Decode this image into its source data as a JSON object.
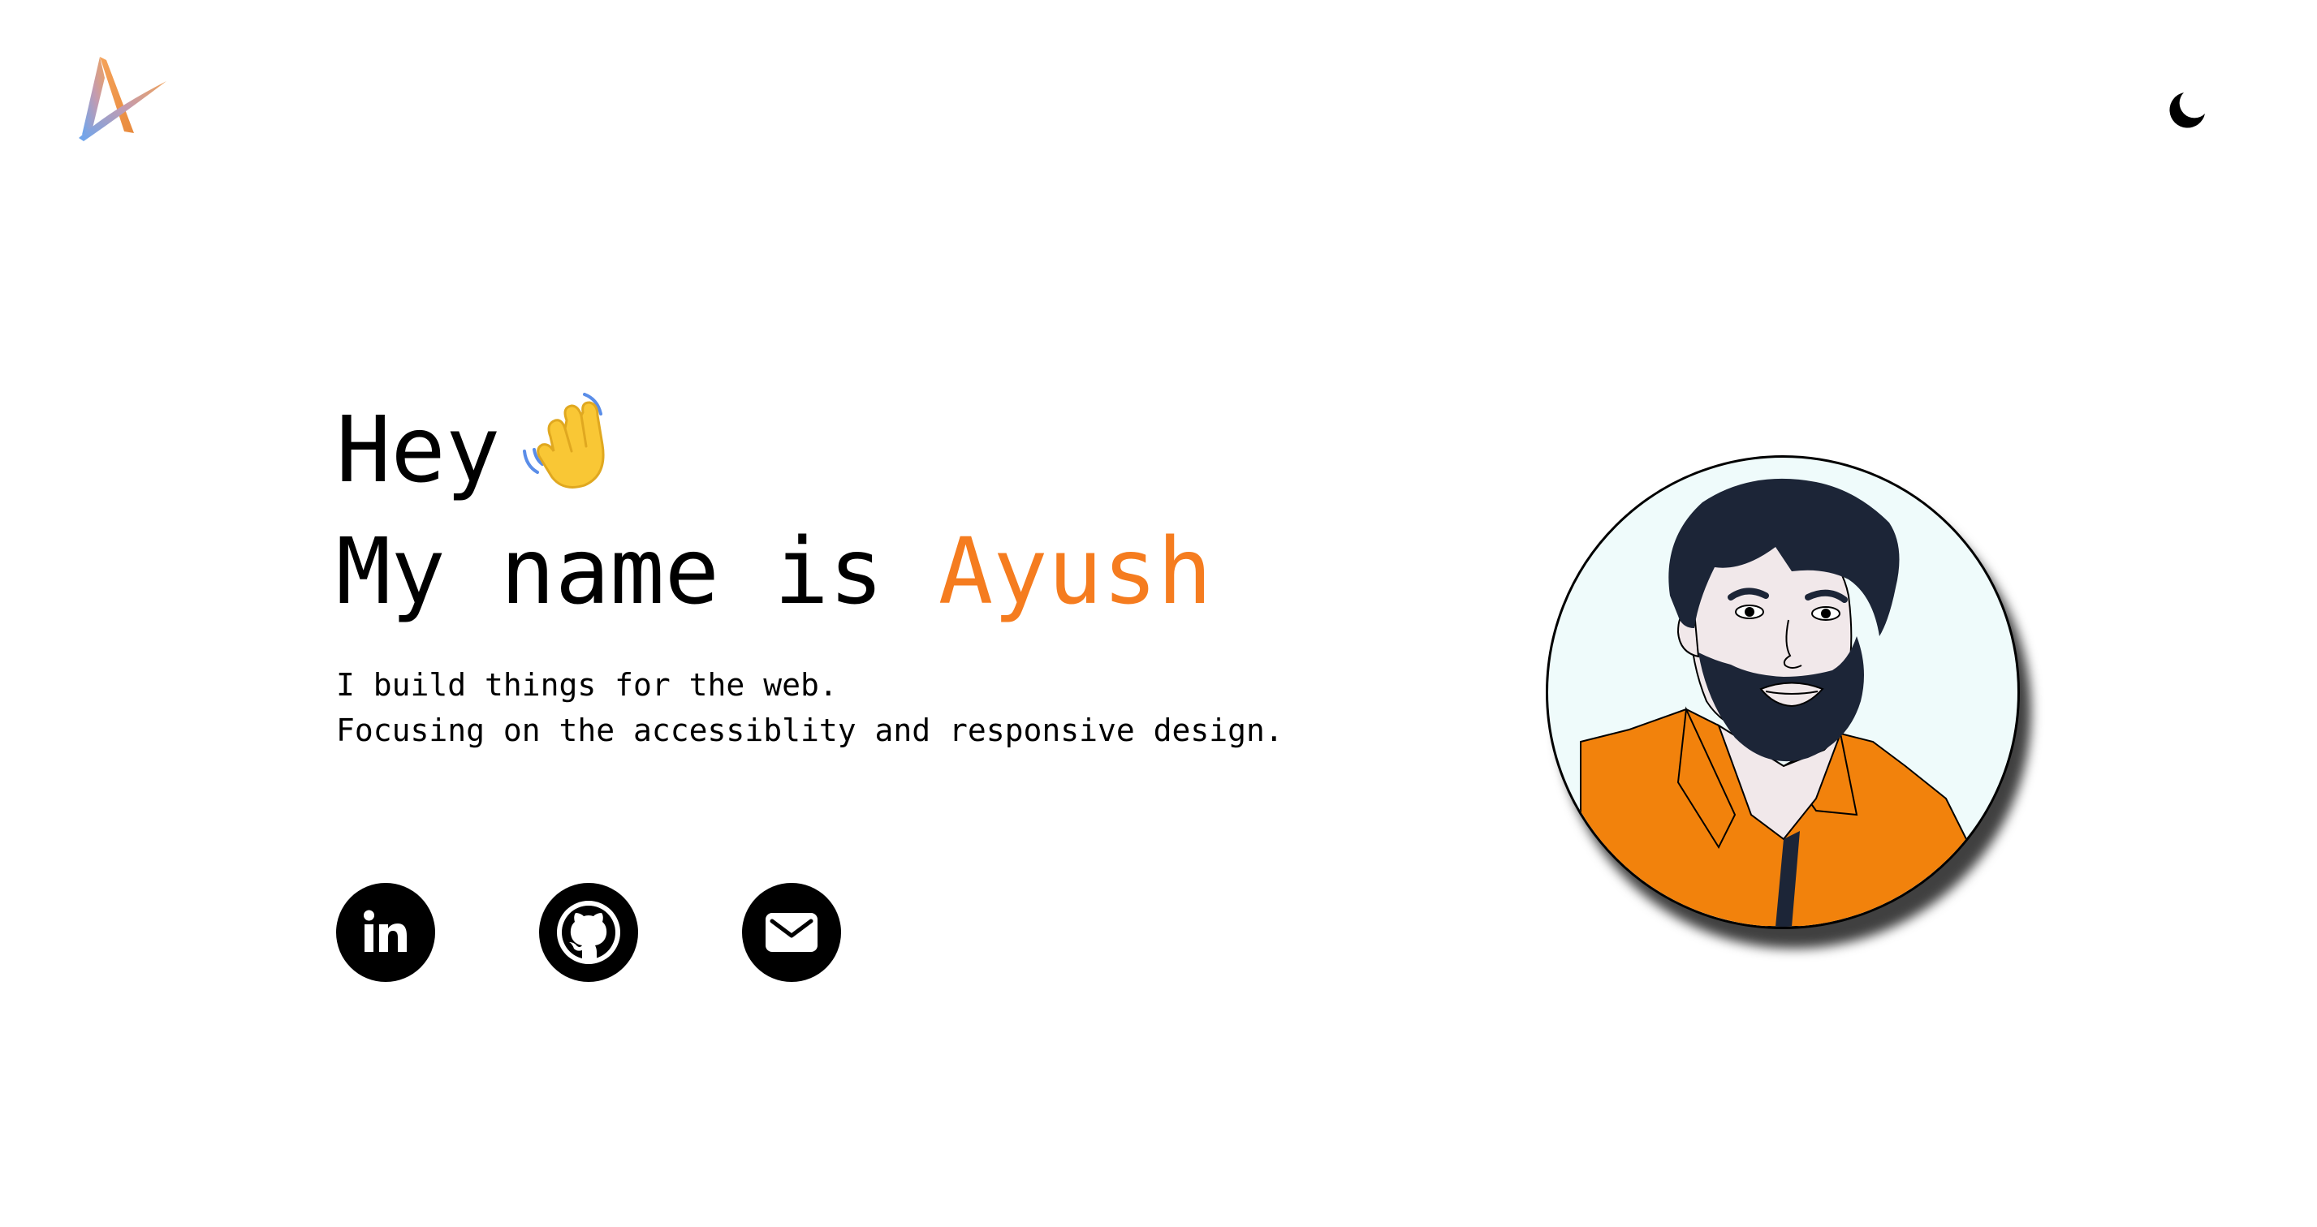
{
  "header": {
    "logo_icon": "a-monogram-logo",
    "theme_toggle_icon": "moon-icon"
  },
  "hero": {
    "greeting": "Hey",
    "wave_emoji": "waving-hand",
    "name_prefix": "My name is ",
    "name": "Ayush",
    "tagline_line1": "I build things for the web.",
    "tagline_line2": "Focusing on the accessiblity and responsive design."
  },
  "socials": [
    {
      "name": "LinkedIn",
      "icon": "linkedin-icon"
    },
    {
      "name": "GitHub",
      "icon": "github-icon"
    },
    {
      "name": "Email",
      "icon": "mail-icon"
    }
  ],
  "colors": {
    "accent": "#f57c1f",
    "text": "#000000",
    "background": "#ffffff",
    "avatar_bg": "#effbfb",
    "shirt": "#f2820c",
    "hair": "#1c2537"
  }
}
